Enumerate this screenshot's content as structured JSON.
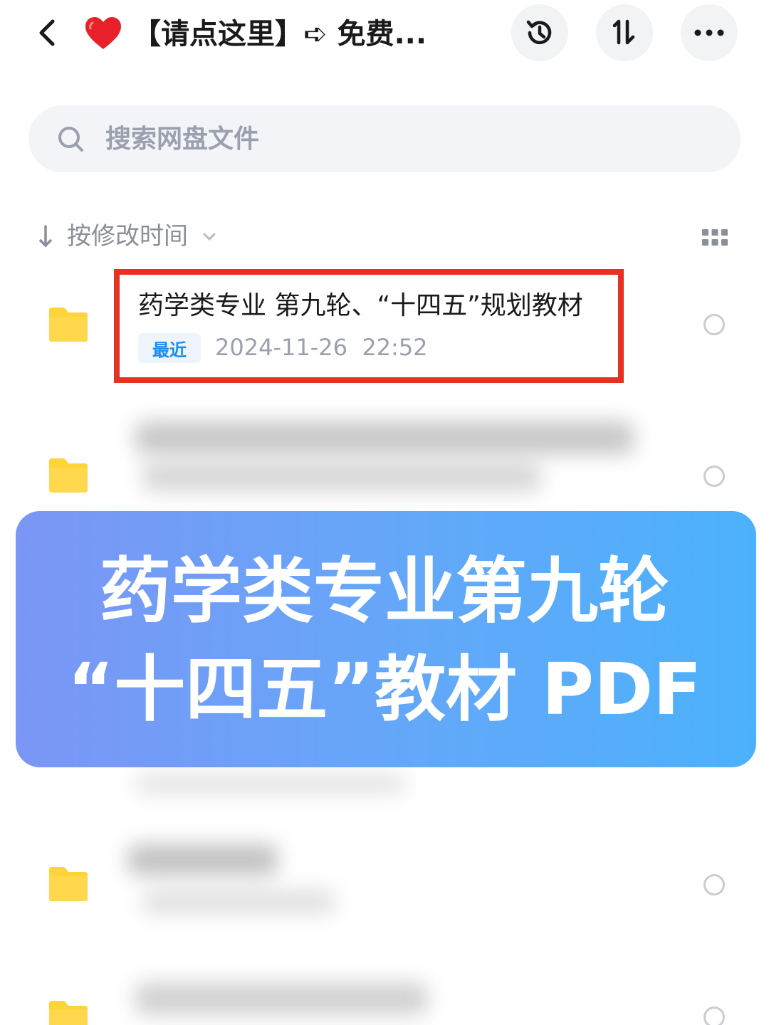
{
  "header": {
    "back_icon": "chevron-left-icon",
    "heart_icon": "heart-icon",
    "title": "【请点这里】➪ 免费...",
    "history_icon": "history-icon",
    "sort_icon": "sort-icon",
    "more_icon": "more-icon"
  },
  "search": {
    "placeholder": "搜索网盘文件",
    "icon": "search-icon"
  },
  "sort": {
    "label": "按修改时间",
    "arrow_icon": "arrow-down-icon",
    "chevron_icon": "chevron-down-icon",
    "view_toggle_icon": "grid-view-icon"
  },
  "files": [
    {
      "name": "药学类专业 第九轮、“十四五”规划教材",
      "badge": "最近",
      "date": "2024-11-26  22:52",
      "icon": "folder-icon",
      "highlighted": true
    },
    {
      "icon": "folder-icon",
      "blurred": true
    },
    {
      "icon": "folder-icon",
      "blurred": true
    },
    {
      "icon": "folder-icon",
      "blurred": true
    }
  ],
  "banner": {
    "line1": "药学类专业第九轮",
    "line2": "“十四五”教材 PDF"
  },
  "colors": {
    "highlight_border": "#e8311f",
    "folder": "#ffd43b",
    "accent_blue": "#1d8cf0",
    "heart": "#e8202a",
    "banner_gradient_start": "#7b96f5",
    "banner_gradient_end": "#4cb1fb"
  }
}
